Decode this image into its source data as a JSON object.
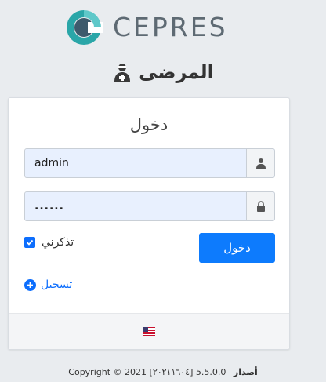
{
  "brand": {
    "name": "CEPRES"
  },
  "portal": {
    "title": "المرضى"
  },
  "login_form": {
    "title": "دخول",
    "username_value": "admin",
    "password_value": "......",
    "remember_label": "تذكرني",
    "remember_checked": true,
    "submit_label": "دخول",
    "register_label": "تسجيل"
  },
  "footer": {
    "language_flag": "us-flag-icon"
  },
  "copyright": {
    "text": "Copyright © 2021 [٢٠٢١١٦٠٤] 5.5.0.0",
    "version_label": "أصدار"
  },
  "colors": {
    "primary": "#0d7bfd",
    "input_autofill": "#e8f0fe",
    "logo_teal": "#2aa6a8",
    "logo_dark": "#3d5a6c"
  }
}
